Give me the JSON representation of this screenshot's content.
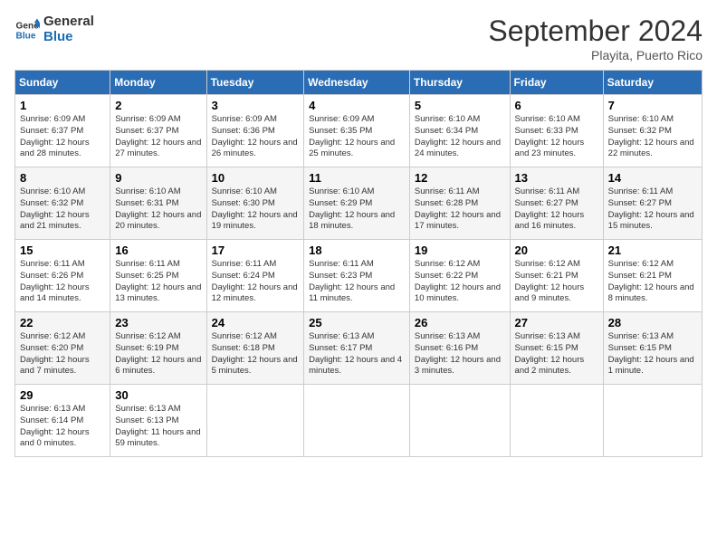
{
  "header": {
    "logo_line1": "General",
    "logo_line2": "Blue",
    "month_title": "September 2024",
    "location": "Playita, Puerto Rico"
  },
  "days_of_week": [
    "Sunday",
    "Monday",
    "Tuesday",
    "Wednesday",
    "Thursday",
    "Friday",
    "Saturday"
  ],
  "weeks": [
    [
      {
        "day": "1",
        "sunrise": "6:09 AM",
        "sunset": "6:37 PM",
        "daylight": "12 hours and 28 minutes."
      },
      {
        "day": "2",
        "sunrise": "6:09 AM",
        "sunset": "6:37 PM",
        "daylight": "12 hours and 27 minutes."
      },
      {
        "day": "3",
        "sunrise": "6:09 AM",
        "sunset": "6:36 PM",
        "daylight": "12 hours and 26 minutes."
      },
      {
        "day": "4",
        "sunrise": "6:09 AM",
        "sunset": "6:35 PM",
        "daylight": "12 hours and 25 minutes."
      },
      {
        "day": "5",
        "sunrise": "6:10 AM",
        "sunset": "6:34 PM",
        "daylight": "12 hours and 24 minutes."
      },
      {
        "day": "6",
        "sunrise": "6:10 AM",
        "sunset": "6:33 PM",
        "daylight": "12 hours and 23 minutes."
      },
      {
        "day": "7",
        "sunrise": "6:10 AM",
        "sunset": "6:32 PM",
        "daylight": "12 hours and 22 minutes."
      }
    ],
    [
      {
        "day": "8",
        "sunrise": "6:10 AM",
        "sunset": "6:32 PM",
        "daylight": "12 hours and 21 minutes."
      },
      {
        "day": "9",
        "sunrise": "6:10 AM",
        "sunset": "6:31 PM",
        "daylight": "12 hours and 20 minutes."
      },
      {
        "day": "10",
        "sunrise": "6:10 AM",
        "sunset": "6:30 PM",
        "daylight": "12 hours and 19 minutes."
      },
      {
        "day": "11",
        "sunrise": "6:10 AM",
        "sunset": "6:29 PM",
        "daylight": "12 hours and 18 minutes."
      },
      {
        "day": "12",
        "sunrise": "6:11 AM",
        "sunset": "6:28 PM",
        "daylight": "12 hours and 17 minutes."
      },
      {
        "day": "13",
        "sunrise": "6:11 AM",
        "sunset": "6:27 PM",
        "daylight": "12 hours and 16 minutes."
      },
      {
        "day": "14",
        "sunrise": "6:11 AM",
        "sunset": "6:27 PM",
        "daylight": "12 hours and 15 minutes."
      }
    ],
    [
      {
        "day": "15",
        "sunrise": "6:11 AM",
        "sunset": "6:26 PM",
        "daylight": "12 hours and 14 minutes."
      },
      {
        "day": "16",
        "sunrise": "6:11 AM",
        "sunset": "6:25 PM",
        "daylight": "12 hours and 13 minutes."
      },
      {
        "day": "17",
        "sunrise": "6:11 AM",
        "sunset": "6:24 PM",
        "daylight": "12 hours and 12 minutes."
      },
      {
        "day": "18",
        "sunrise": "6:11 AM",
        "sunset": "6:23 PM",
        "daylight": "12 hours and 11 minutes."
      },
      {
        "day": "19",
        "sunrise": "6:12 AM",
        "sunset": "6:22 PM",
        "daylight": "12 hours and 10 minutes."
      },
      {
        "day": "20",
        "sunrise": "6:12 AM",
        "sunset": "6:21 PM",
        "daylight": "12 hours and 9 minutes."
      },
      {
        "day": "21",
        "sunrise": "6:12 AM",
        "sunset": "6:21 PM",
        "daylight": "12 hours and 8 minutes."
      }
    ],
    [
      {
        "day": "22",
        "sunrise": "6:12 AM",
        "sunset": "6:20 PM",
        "daylight": "12 hours and 7 minutes."
      },
      {
        "day": "23",
        "sunrise": "6:12 AM",
        "sunset": "6:19 PM",
        "daylight": "12 hours and 6 minutes."
      },
      {
        "day": "24",
        "sunrise": "6:12 AM",
        "sunset": "6:18 PM",
        "daylight": "12 hours and 5 minutes."
      },
      {
        "day": "25",
        "sunrise": "6:13 AM",
        "sunset": "6:17 PM",
        "daylight": "12 hours and 4 minutes."
      },
      {
        "day": "26",
        "sunrise": "6:13 AM",
        "sunset": "6:16 PM",
        "daylight": "12 hours and 3 minutes."
      },
      {
        "day": "27",
        "sunrise": "6:13 AM",
        "sunset": "6:15 PM",
        "daylight": "12 hours and 2 minutes."
      },
      {
        "day": "28",
        "sunrise": "6:13 AM",
        "sunset": "6:15 PM",
        "daylight": "12 hours and 1 minute."
      }
    ],
    [
      {
        "day": "29",
        "sunrise": "6:13 AM",
        "sunset": "6:14 PM",
        "daylight": "12 hours and 0 minutes."
      },
      {
        "day": "30",
        "sunrise": "6:13 AM",
        "sunset": "6:13 PM",
        "daylight": "11 hours and 59 minutes."
      },
      null,
      null,
      null,
      null,
      null
    ]
  ]
}
